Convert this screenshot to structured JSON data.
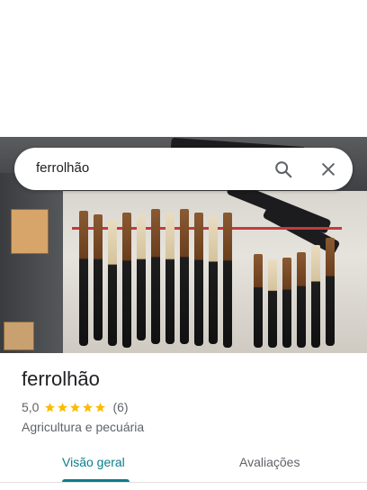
{
  "search": {
    "query": "ferrolhão"
  },
  "place": {
    "name": "ferrolhão",
    "rating": "5,0",
    "stars": 5,
    "review_count": "(6)",
    "category": "Agricultura e pecuária"
  },
  "tabs": [
    {
      "label": "Visão geral",
      "selected": true
    },
    {
      "label": "Avaliações",
      "selected": false
    }
  ],
  "colors": {
    "accent": "#0b7d8c",
    "star": "#fbbc04"
  },
  "icons": {
    "search": "search-icon",
    "close": "close-icon"
  }
}
